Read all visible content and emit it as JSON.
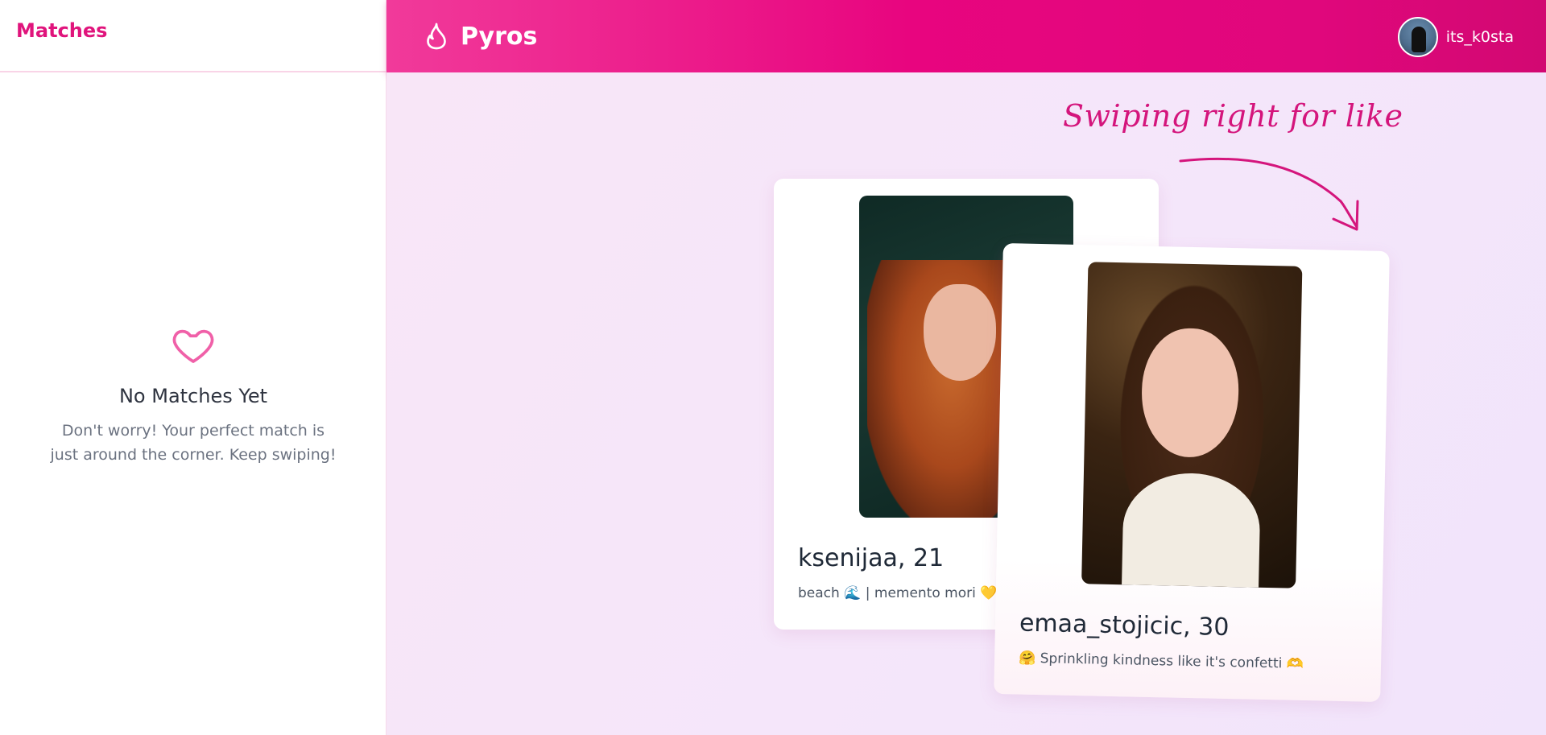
{
  "sidebar": {
    "title": "Matches",
    "empty": {
      "icon": "heart-outline-icon",
      "title": "No Matches Yet",
      "text": "Don't worry! Your perfect match is just around the corner. Keep swiping!"
    }
  },
  "header": {
    "brand": "Pyros",
    "brand_icon": "flame-icon",
    "user": {
      "username": "its_k0sta",
      "avatar_icon": "avatar"
    }
  },
  "main": {
    "hint": "Swiping right for like",
    "cards": [
      {
        "name_age": "ksenijaa, 21",
        "bio": "beach 🌊 | memento mori 💛 💗"
      },
      {
        "name_age": "emaa_stojicic, 30",
        "bio": "🤗 Sprinkling kindness like it's confetti 🫶"
      }
    ]
  },
  "colors": {
    "accent": "#e0147c",
    "header_gradient_start": "#f13a9a",
    "header_gradient_end": "#d20872",
    "background": "#f8e6f7"
  }
}
